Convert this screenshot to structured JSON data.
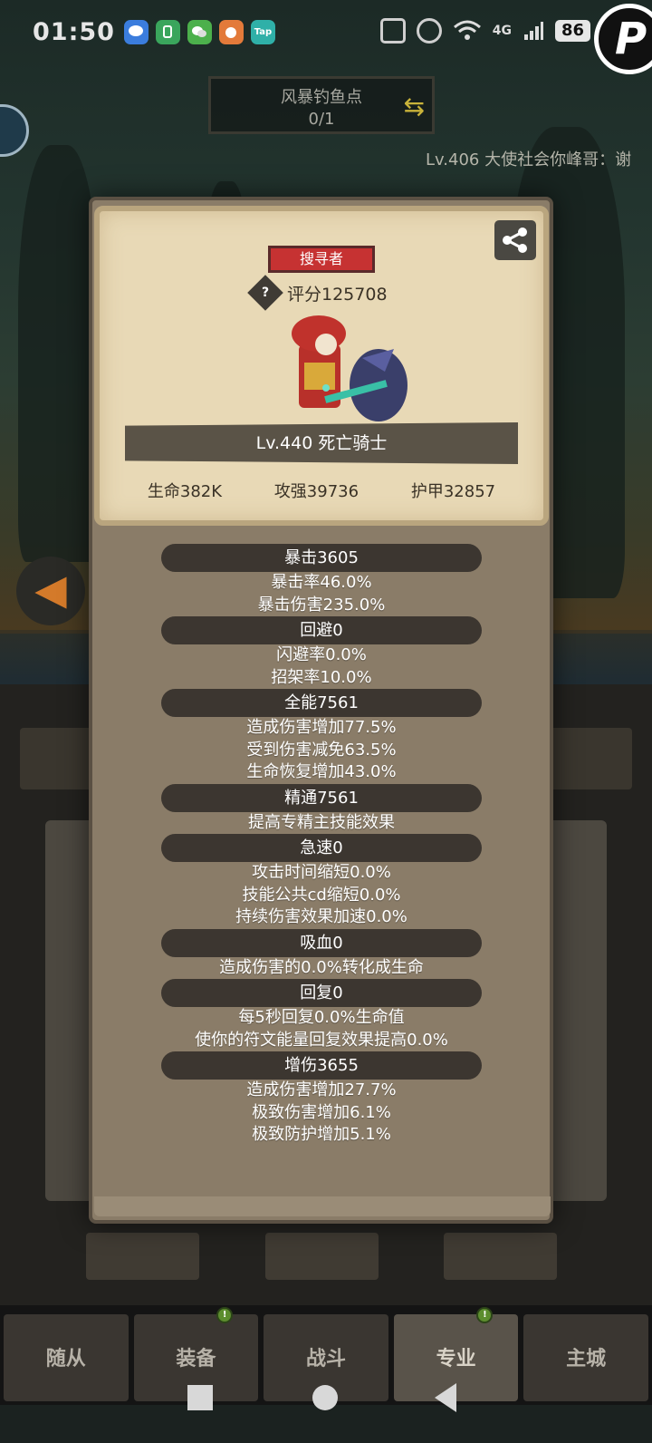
{
  "status_bar": {
    "time": "01:50",
    "battery": "86",
    "network": "4G",
    "notification_icons": [
      "message-icon",
      "tiktok-icon",
      "wechat-icon",
      "game-icon",
      "tap-icon"
    ],
    "tap_label": "Tap"
  },
  "fishing": {
    "name": "风暴钓鱼点",
    "count": "0/1"
  },
  "scroll_message": "Lv.406 大使社会你峰哥：谢",
  "hero": {
    "role": "搜寻者",
    "score": "评分125708",
    "level_name": "Lv.440 死亡骑士",
    "stats": {
      "hp": "生命382K",
      "attack": "攻强39736",
      "armor": "护甲32857"
    }
  },
  "attributes": [
    {
      "head": "暴击3605",
      "lines": [
        "暴击率46.0%",
        "暴击伤害235.0%"
      ]
    },
    {
      "head": "回避0",
      "lines": [
        "闪避率0.0%",
        "招架率10.0%"
      ]
    },
    {
      "head": "全能7561",
      "lines": [
        "造成伤害增加77.5%",
        "受到伤害减免63.5%",
        "生命恢复增加43.0%"
      ]
    },
    {
      "head": "精通7561",
      "lines": [
        "提高专精主技能效果"
      ]
    },
    {
      "head": "急速0",
      "lines": [
        "攻击时间缩短0.0%",
        "技能公共cd缩短0.0%",
        "持续伤害效果加速0.0%"
      ]
    },
    {
      "head": "吸血0",
      "lines": [
        "造成伤害的0.0%转化成生命"
      ]
    },
    {
      "head": "回复0",
      "lines": [
        "每5秒回复0.0%生命值",
        "使你的符文能量回复效果提高0.0%"
      ]
    },
    {
      "head": "增伤3655",
      "lines": [
        "造成伤害增加27.7%",
        "极致伤害增加6.1%",
        "极致防护增加5.1%"
      ]
    }
  ],
  "bottom_nav": {
    "items": [
      {
        "label": "随从",
        "badge": ""
      },
      {
        "label": "装备",
        "badge": "!"
      },
      {
        "label": "战斗",
        "badge": ""
      },
      {
        "label": "专业",
        "badge": "!"
      },
      {
        "label": "主城",
        "badge": ""
      }
    ]
  },
  "colors": {
    "role_badge": "#c63232",
    "card_bg": "#e8d9b6",
    "modal_bg": "#8a7c68",
    "attr_head_bg": "#3c3630"
  }
}
